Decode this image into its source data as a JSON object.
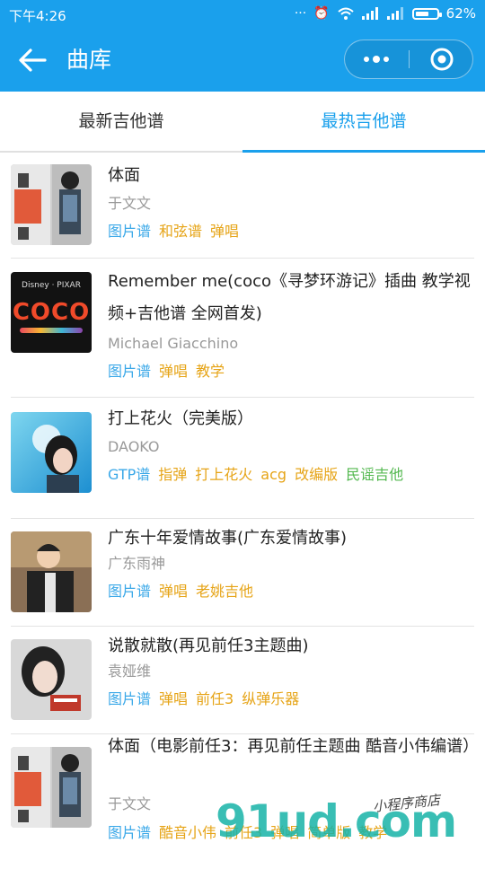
{
  "status": {
    "time": "下午4:26",
    "battery": "62%",
    "battery_level": 0.62
  },
  "nav": {
    "title": "曲库"
  },
  "tabs": [
    {
      "label": "最新吉他谱",
      "active": false
    },
    {
      "label": "最热吉他谱",
      "active": true
    }
  ],
  "songs": [
    {
      "title": "体面",
      "artist": "于文文",
      "tags": [
        {
          "text": "图片谱",
          "color": "blue"
        },
        {
          "text": "和弦谱",
          "color": "orange"
        },
        {
          "text": "弹唱",
          "color": "orange"
        }
      ]
    },
    {
      "title": "Remember me(coco《寻梦环游记》插曲 教学视频+吉他谱 全网首发)",
      "artist": "Michael Giacchino",
      "cover_text": "COCO",
      "cover_brand": "Disney · PIXAR",
      "tags": [
        {
          "text": "图片谱",
          "color": "blue"
        },
        {
          "text": "弹唱",
          "color": "orange"
        },
        {
          "text": "教学",
          "color": "orange"
        }
      ]
    },
    {
      "title": "打上花火（完美版）",
      "artist": "DAOKO",
      "tags": [
        {
          "text": "GTP谱",
          "color": "blue"
        },
        {
          "text": "指弹",
          "color": "orange"
        },
        {
          "text": "打上花火",
          "color": "orange"
        },
        {
          "text": "acg",
          "color": "orange"
        },
        {
          "text": "改编版",
          "color": "orange"
        },
        {
          "text": "民谣吉他",
          "color": "green"
        }
      ]
    },
    {
      "title": "广东十年爱情故事(广东爱情故事)",
      "artist": "广东雨神",
      "tags": [
        {
          "text": "图片谱",
          "color": "blue"
        },
        {
          "text": "弹唱",
          "color": "orange"
        },
        {
          "text": "老姚吉他",
          "color": "orange"
        }
      ]
    },
    {
      "title": "说散就散(再见前任3主题曲)",
      "artist": "袁娅维",
      "tags": [
        {
          "text": "图片谱",
          "color": "blue"
        },
        {
          "text": "弹唱",
          "color": "orange"
        },
        {
          "text": "前任3",
          "color": "orange"
        },
        {
          "text": "纵弹乐器",
          "color": "orange"
        }
      ]
    },
    {
      "title": "体面（电影前任3：再见前任主题曲 酷音小伟编谱）",
      "artist": "于文文",
      "tags": [
        {
          "text": "图片谱",
          "color": "blue"
        },
        {
          "text": "酷音小伟",
          "color": "orange"
        },
        {
          "text": "前任3",
          "color": "orange"
        },
        {
          "text": "弹唱",
          "color": "orange"
        },
        {
          "text": "简单版",
          "color": "orange"
        },
        {
          "text": "教学",
          "color": "orange"
        }
      ]
    }
  ],
  "watermark": {
    "text": "91ud.com",
    "sub": "小程序商店"
  },
  "colors": {
    "accent": "#1aa0ec",
    "tag_blue": "#3aa8e8",
    "tag_orange": "#e6a417",
    "tag_green": "#53b84f"
  }
}
